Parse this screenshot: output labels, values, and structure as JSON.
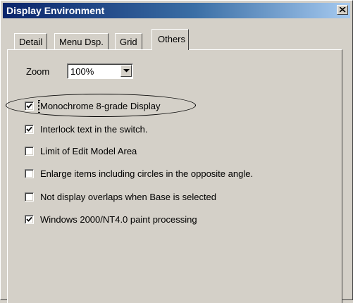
{
  "window": {
    "title": "Display Environment"
  },
  "tabs": [
    {
      "label": "Detail",
      "active": false
    },
    {
      "label": "Menu Dsp.",
      "active": false
    },
    {
      "label": "Grid",
      "active": false
    },
    {
      "label": "Others",
      "active": true
    }
  ],
  "zoom": {
    "label": "Zoom",
    "value": "100%"
  },
  "options": [
    {
      "label": "Monochrome 8-grade Display",
      "checked": true,
      "focused": true
    },
    {
      "label": "Interlock text in the switch.",
      "checked": true
    },
    {
      "label": "Limit of Edit Model Area",
      "checked": false
    },
    {
      "label": "Enlarge items including circles in the opposite angle.",
      "checked": false
    },
    {
      "label": "Not display overlaps when Base is selected",
      "checked": false
    },
    {
      "label": "Windows 2000/NT4.0 paint processing",
      "checked": true
    }
  ]
}
